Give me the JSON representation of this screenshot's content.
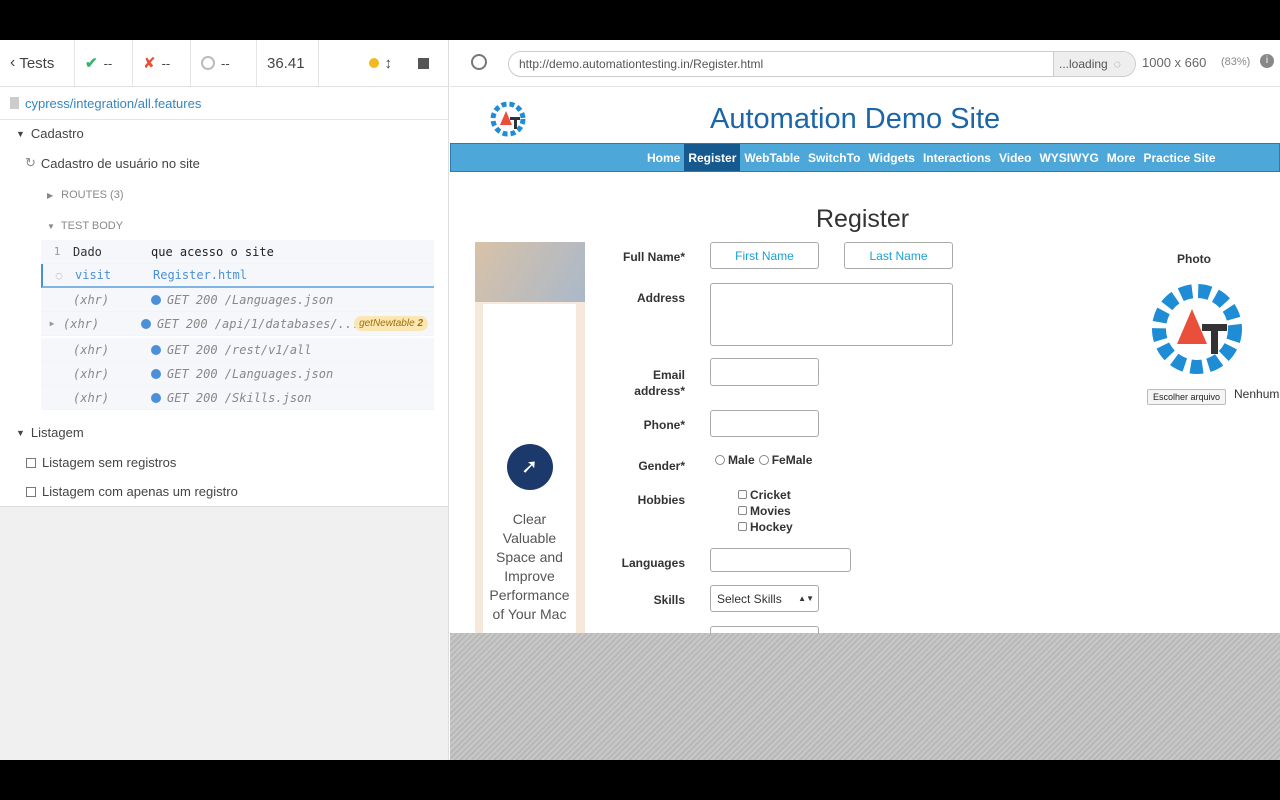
{
  "reporter": {
    "back_label": "Tests",
    "passed": "--",
    "failed": "--",
    "pending": "--",
    "duration": "36.41",
    "spec_path": "cypress/integration/all.features",
    "suite1": "Cadastro",
    "test1": "Cadastro de usuário no site",
    "routes": "ROUTES (3)",
    "test_body": "TEST BODY",
    "commands": [
      {
        "num": "1",
        "name": "Dado",
        "msg": "que acesso o site"
      },
      {
        "num": "",
        "name": "visit",
        "msg": "Register.html"
      },
      {
        "num": "",
        "name": "(xhr)",
        "msg": "GET 200 /Languages.json"
      },
      {
        "num": "",
        "name": "(xhr)",
        "msg": "GET 200 /api/1/databases/...",
        "alias": "getNewtable",
        "count": "2"
      },
      {
        "num": "",
        "name": "(xhr)",
        "msg": "GET 200 /rest/v1/all"
      },
      {
        "num": "",
        "name": "(xhr)",
        "msg": "GET 200 /Languages.json"
      },
      {
        "num": "",
        "name": "(xhr)",
        "msg": "GET 200 /Skills.json"
      }
    ],
    "suite2": "Listagem",
    "test2": "Listagem sem registros",
    "test3": "Listagem com apenas um registro"
  },
  "aut": {
    "url": "http://demo.automationtesting.in/Register.html",
    "loading": "...loading",
    "viewport": "1000 x 660",
    "scale": "(83%)"
  },
  "site": {
    "title": "Automation Demo Site",
    "nav": [
      "Home",
      "Register",
      "WebTable",
      "SwitchTo",
      "Widgets",
      "Interactions",
      "Video",
      "WYSIWYG",
      "More",
      "Practice Site"
    ],
    "heading": "Register",
    "full_name": "Full Name*",
    "first_ph": "First Name",
    "last_ph": "Last Name",
    "address": "Address",
    "email1": "Email",
    "email2": "address*",
    "phone": "Phone*",
    "gender": "Gender*",
    "male": "Male",
    "female": "FeMale",
    "hobbies": "Hobbies",
    "cricket": "Cricket",
    "movies": "Movies",
    "hockey": "Hockey",
    "languages": "Languages",
    "skills": "Skills",
    "skills_sel": "Select Skills",
    "photo": "Photo",
    "choose_file": "Escolher arquivo",
    "no_file": "Nenhum",
    "ad_text": "Clear Valuable Space and Improve Performance of Your Mac"
  }
}
